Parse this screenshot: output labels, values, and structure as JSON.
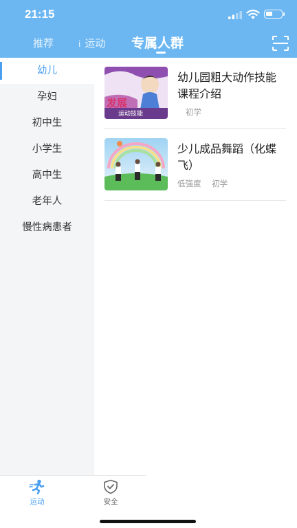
{
  "status_bar": {
    "time": "21:15"
  },
  "top_tabs": [
    {
      "label": "推荐"
    },
    {
      "label": "运动"
    },
    {
      "label": "专属人群"
    }
  ],
  "sidebar": {
    "items": [
      {
        "label": "幼儿"
      },
      {
        "label": "孕妇"
      },
      {
        "label": "初中生"
      },
      {
        "label": "小学生"
      },
      {
        "label": "高中生"
      },
      {
        "label": "老年人"
      },
      {
        "label": "慢性病患者"
      }
    ]
  },
  "cards": [
    {
      "title": "幼儿园粗大动作技能课程介绍",
      "tags": [
        "",
        "初学"
      ],
      "thumb_text": [
        "发展",
        "运动技能"
      ]
    },
    {
      "title": "少儿成品舞蹈（化蝶飞）",
      "tags": [
        "低强度",
        "初学"
      ]
    }
  ],
  "bottom_nav": [
    {
      "label": "运动"
    },
    {
      "label": "安全"
    }
  ],
  "colors": {
    "header": "#6cb7f2",
    "accent": "#4a9ff0"
  }
}
